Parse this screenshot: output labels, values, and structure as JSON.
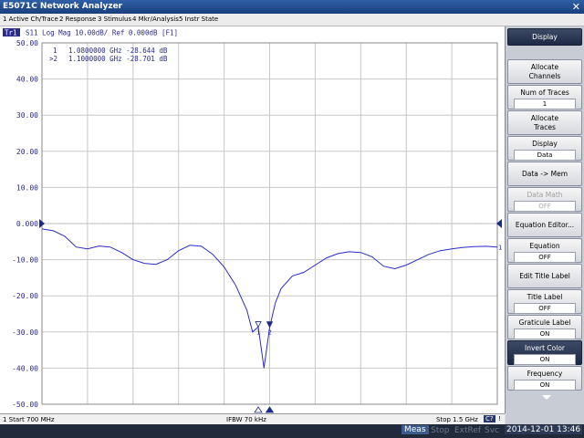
{
  "window": {
    "title": "E5071C Network Analyzer",
    "close": "✕"
  },
  "menu": [
    "1 Active Ch/Trace",
    "2 Response",
    "3 Stimulus",
    "4 Mkr/Analysis",
    "5 Instr State"
  ],
  "trace_header": {
    "tag": "Tr1",
    "text": "S11 Log Mag 10.00dB/ Ref 0.000dB [F1]"
  },
  "markers": [
    {
      "label": "1",
      "text": "1.0800000 GHz -28.644 dB",
      "freq_ghz": 1.08,
      "db": -28.644
    },
    {
      "label": ">2",
      "text": "1.1000000 GHz -28.701 dB",
      "freq_ghz": 1.1,
      "db": -28.701
    }
  ],
  "y_ticks": [
    "50.00",
    "40.00",
    "30.00",
    "20.00",
    "10.00",
    "0.000",
    "-10.00",
    "-20.00",
    "-30.00",
    "-40.00",
    "-50.00"
  ],
  "chart_data": {
    "type": "line",
    "title": "S11 Log Mag 10.00dB/ Ref 0.000dB [F1]",
    "xlim": [
      0.7,
      1.5
    ],
    "ylim": [
      -50,
      50
    ],
    "grid": true,
    "series": [
      {
        "name": "S11",
        "color": "#2b2bc8",
        "x": [
          0.7,
          0.72,
          0.74,
          0.76,
          0.78,
          0.8,
          0.82,
          0.84,
          0.86,
          0.88,
          0.9,
          0.92,
          0.94,
          0.96,
          0.98,
          1.0,
          1.02,
          1.04,
          1.06,
          1.07,
          1.08,
          1.09,
          1.1,
          1.11,
          1.12,
          1.14,
          1.16,
          1.18,
          1.2,
          1.22,
          1.24,
          1.26,
          1.28,
          1.3,
          1.32,
          1.34,
          1.36,
          1.38,
          1.4,
          1.42,
          1.44,
          1.46,
          1.48,
          1.5
        ],
        "y": [
          -1.5,
          -2.0,
          -3.5,
          -6.5,
          -7.0,
          -6.2,
          -6.5,
          -8.0,
          -10.0,
          -11.0,
          -11.3,
          -10.0,
          -7.5,
          -6.0,
          -6.3,
          -8.5,
          -12.0,
          -17.0,
          -24.0,
          -30.0,
          -28.6,
          -40.0,
          -28.7,
          -22.0,
          -18.0,
          -14.5,
          -13.5,
          -11.5,
          -9.5,
          -8.3,
          -7.8,
          -8.0,
          -9.2,
          -11.8,
          -12.5,
          -11.5,
          -10.0,
          -8.5,
          -7.5,
          -7.0,
          -6.6,
          -6.4,
          -6.3,
          -6.5
        ]
      }
    ],
    "marker_points": [
      {
        "label": "1",
        "x": 1.08,
        "y": -28.644
      },
      {
        "label": "2",
        "x": 1.1,
        "y": -28.701
      }
    ]
  },
  "status": {
    "start": "1  Start 700 MHz",
    "ifbw": "IFBW 70 kHz",
    "stop": "Stop 1.5 GHz",
    "c_badge": "C?",
    "bang": "!"
  },
  "bottom": {
    "meas": "Meas",
    "stop": "Stop",
    "extref": "ExtRef",
    "svc": "Svc",
    "datetime": "2014-12-01 13:46"
  },
  "softkeys": [
    {
      "label": "Display",
      "style": "dark"
    },
    {
      "label": "Allocate\nChannels"
    },
    {
      "label": "Num of Traces",
      "value": "1"
    },
    {
      "label": "Allocate\nTraces"
    },
    {
      "label": "Display",
      "value": "Data"
    },
    {
      "label": "Data -> Mem"
    },
    {
      "label": "Data Math",
      "value": "OFF",
      "style": "disabled"
    },
    {
      "label": "Equation Editor..."
    },
    {
      "label": "Equation",
      "value": "OFF"
    },
    {
      "label": "Edit Title Label"
    },
    {
      "label": "Title Label",
      "value": "OFF"
    },
    {
      "label": "Graticule Label",
      "value": "ON"
    },
    {
      "label": "Invert Color",
      "value": "ON",
      "style": "dark"
    },
    {
      "label": "Frequency",
      "value": "ON"
    }
  ],
  "colors": {
    "trace": "#2b2bc8",
    "grid": "#c8c8c8",
    "axis_text": "#2a2a8a",
    "marker": "#1e2a8a"
  }
}
